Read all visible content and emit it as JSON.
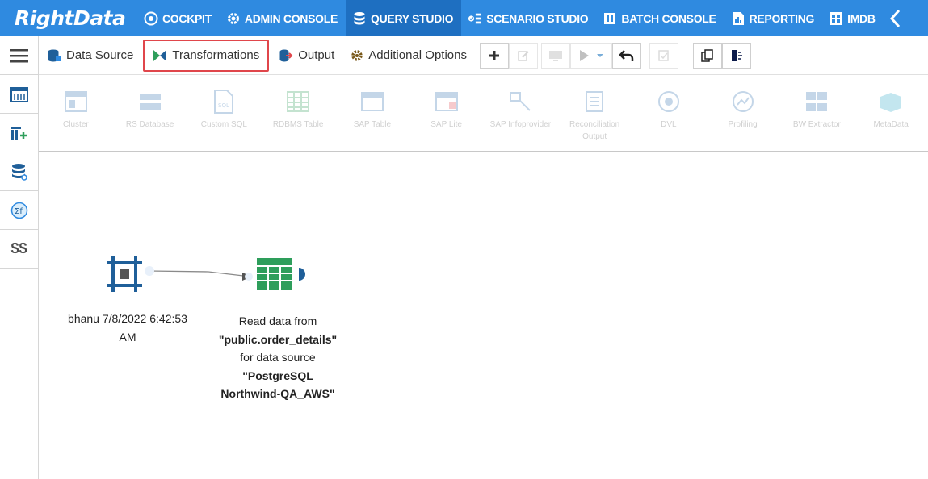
{
  "app": {
    "logo_text": "RightData"
  },
  "nav": {
    "items": [
      {
        "label": "COCKPIT",
        "icon": "cockpit-icon"
      },
      {
        "label": "ADMIN CONSOLE",
        "icon": "gear-icon"
      },
      {
        "label": "QUERY STUDIO",
        "icon": "database-icon",
        "active": true
      },
      {
        "label": "SCENARIO STUDIO",
        "icon": "scenario-icon"
      },
      {
        "label": "BATCH CONSOLE",
        "icon": "batch-icon"
      },
      {
        "label": "REPORTING",
        "icon": "report-icon"
      },
      {
        "label": "IMDB",
        "icon": "imdb-icon"
      }
    ],
    "collapse_icon": "chevron-left-icon"
  },
  "sidebar": {
    "items": [
      {
        "icon": "hamburger-menu-icon"
      },
      {
        "icon": "calendar-grid-icon"
      },
      {
        "icon": "add-table-icon"
      },
      {
        "icon": "database-query-icon"
      },
      {
        "icon": "function-icon"
      },
      {
        "label": "$$"
      }
    ]
  },
  "toolbar": {
    "tabs": [
      {
        "label": "Data Source",
        "icon": "data-source-icon"
      },
      {
        "label": "Transformations",
        "icon": "transform-icon",
        "highlighted": true
      },
      {
        "label": "Output",
        "icon": "output-icon"
      },
      {
        "label": "Additional Options",
        "icon": "gear-icon"
      }
    ]
  },
  "palette": {
    "items": [
      {
        "label": "Cluster"
      },
      {
        "label": "RS Database"
      },
      {
        "label": "Custom SQL"
      },
      {
        "label": "RDBMS Table"
      },
      {
        "label": "SAP Table"
      },
      {
        "label": "SAP Lite"
      },
      {
        "label": "SAP Infoprovider"
      },
      {
        "label": "Reconciliation Output"
      },
      {
        "label": "DVL"
      },
      {
        "label": "Profiling"
      },
      {
        "label": "BW Extractor"
      },
      {
        "label": "MetaData"
      }
    ]
  },
  "canvas": {
    "source_node": {
      "caption_line1": "bhanu 7/8/2022 6:42:53",
      "caption_line2": "AM"
    },
    "read_node": {
      "line1": "Read data from",
      "line2": "\"public.order_details\"",
      "line3": "for data source",
      "line4": "\"PostgreSQL",
      "line5": "Northwind-QA_AWS\""
    }
  },
  "colors": {
    "nav_bg": "#2f8ae0",
    "nav_active": "#1e6fc1",
    "highlight": "#e0464b",
    "table_green": "#2e9e5b",
    "node_blue": "#1f5f99"
  }
}
